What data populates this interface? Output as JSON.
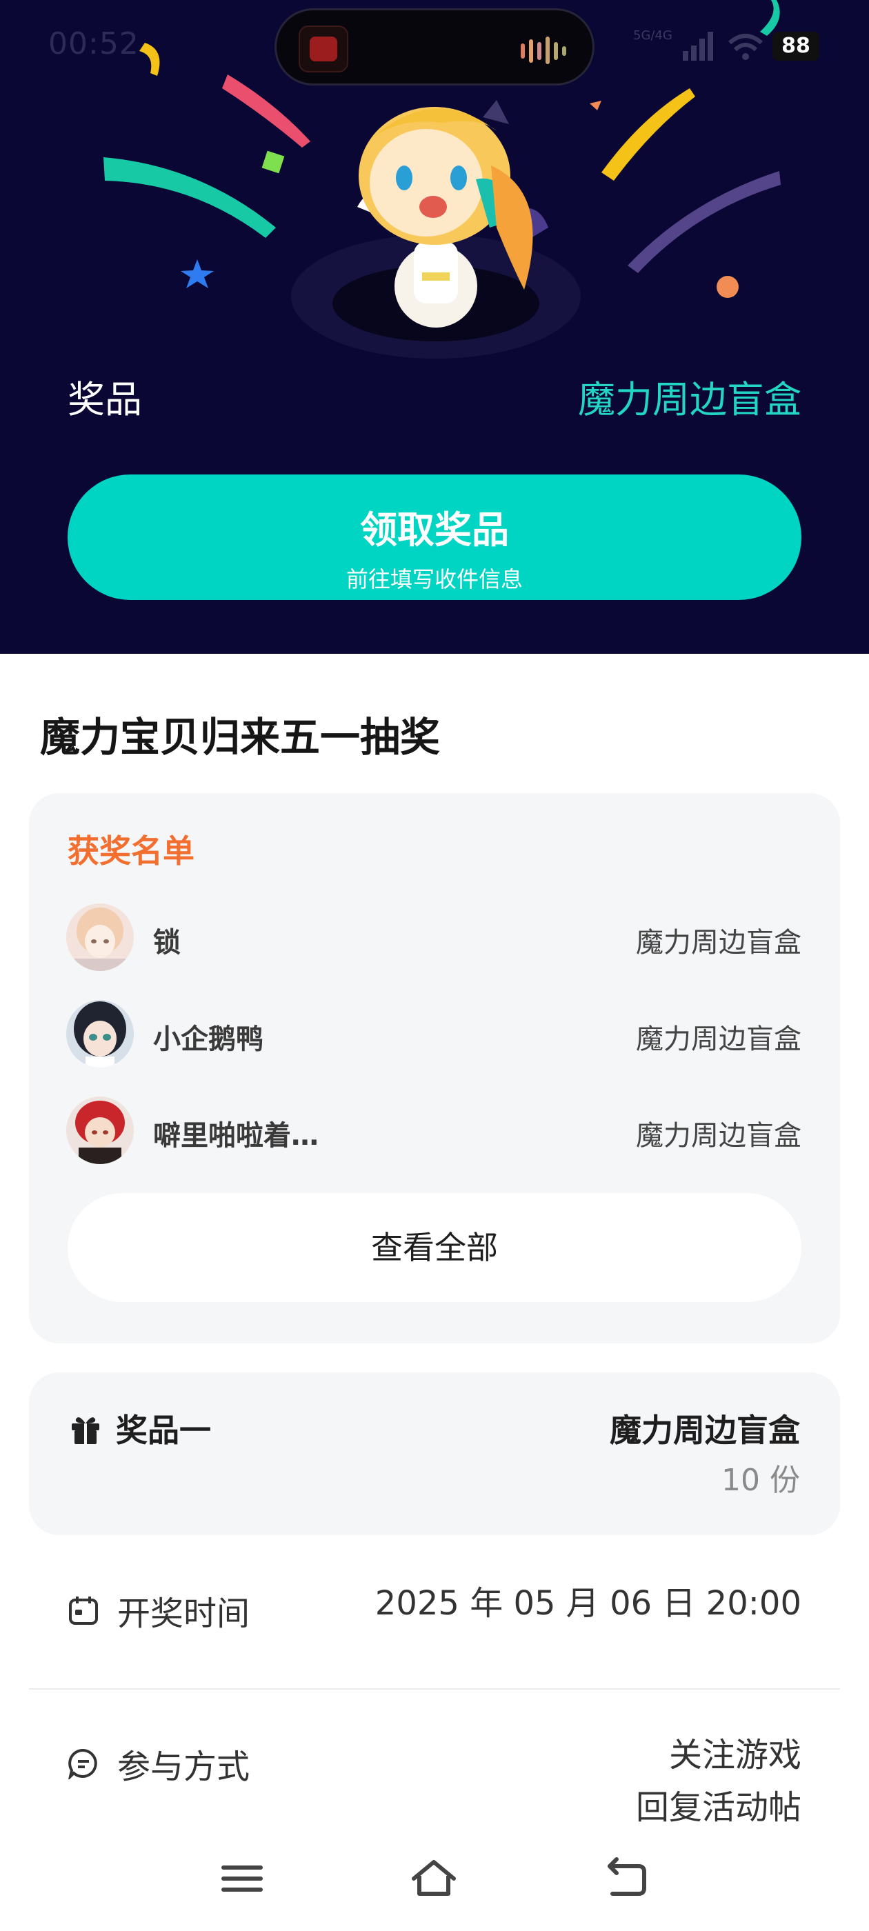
{
  "status_bar": {
    "time": "00:52",
    "network": "5G/4G",
    "battery": "88"
  },
  "hero": {
    "prize_label": "奖品",
    "prize_value": "魔力周边盲盒",
    "claim_title": "领取奖品",
    "claim_subtitle": "前往填写收件信息"
  },
  "event": {
    "title": "魔力宝贝归来五一抽奖"
  },
  "winners": {
    "title": "获奖名单",
    "list": [
      {
        "name": "锁",
        "prize": "魔力周边盲盒"
      },
      {
        "name": "小企鹅鸭",
        "prize": "魔力周边盲盒"
      },
      {
        "name": "噼里啪啦着…",
        "prize": "魔力周边盲盒"
      }
    ],
    "view_all": "查看全部"
  },
  "prize_detail": {
    "label": "奖品一",
    "name": "魔力周边盲盒",
    "count": "10 份"
  },
  "draw_time": {
    "label": "开奖时间",
    "value": "2025 年 05 月 06 日 20:00"
  },
  "participation": {
    "label": "参与方式",
    "line1": "关注游戏",
    "line2": "回复活动帖"
  },
  "colors": {
    "hero_bg": "#0a0734",
    "accent": "#00d4c3",
    "winners_title": "#f26f30"
  },
  "icons": [
    "gift-icon",
    "calendar-icon",
    "chat-icon",
    "menu-icon",
    "home-icon",
    "back-icon"
  ]
}
